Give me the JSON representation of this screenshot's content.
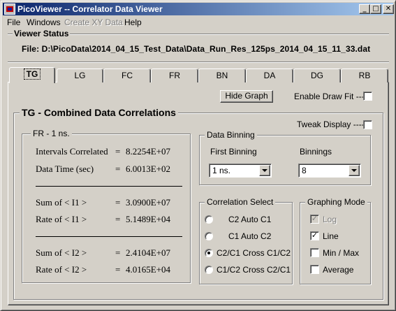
{
  "window": {
    "title": "PicoViewer -- Correlator Data Viewer"
  },
  "titlebar_buttons": {
    "minimize": "_",
    "maximize": "□",
    "close": "✕"
  },
  "menu": [
    {
      "label": "File",
      "enabled": true
    },
    {
      "label": "Windows",
      "enabled": true
    },
    {
      "label": "Create XY Data",
      "enabled": false
    },
    {
      "label": "Help",
      "enabled": true
    }
  ],
  "viewer_status": {
    "title": "Viewer  Status",
    "file_line": "File: D:\\PicoData\\2014_04_15_Test_Data\\Data_Run_Res_125ps_2014_04_15_11_33.dat"
  },
  "tabs": [
    "TG",
    "LG",
    "FC",
    "FR",
    "BN",
    "DA",
    "DG",
    "RB"
  ],
  "active_tab": "TG",
  "toolbar": {
    "hide_graph": "Hide Graph",
    "enable_draw_fit": "Enable Draw Fit ----"
  },
  "panel": {
    "title": "TG - Combined Data Correlations",
    "tweak_display": "Tweak Display ----"
  },
  "fr": {
    "title": "FR - 1 ns.",
    "rows": [
      {
        "label": "Intervals Correlated",
        "eq": "=",
        "value": "8.2254E+07"
      },
      {
        "label": "Data Time (sec)",
        "eq": "=",
        "value": "6.0013E+02"
      },
      {
        "label": "Sum of < I1 >",
        "eq": "=",
        "value": "3.0900E+07"
      },
      {
        "label": "Rate of < I1 >",
        "eq": "=",
        "value": "5.1489E+04"
      },
      {
        "label": "Sum of < I2 >",
        "eq": "=",
        "value": "2.4104E+07"
      },
      {
        "label": "Rate of < I2 >",
        "eq": "=",
        "value": "4.0165E+04"
      }
    ]
  },
  "binning": {
    "title": "Data Binning",
    "first_label": "First Binning",
    "first_value": "1 ns.",
    "binnings_label": "Binnings",
    "binnings_value": "8"
  },
  "correlation": {
    "title": "Correlation Select",
    "options": [
      {
        "label": "C2  Auto  C1",
        "selected": false
      },
      {
        "label": "C1  Auto  C2",
        "selected": false
      },
      {
        "label": "C2/C1 Cross C1/C2",
        "selected": true
      },
      {
        "label": "C1/C2 Cross C2/C1",
        "selected": false
      }
    ]
  },
  "graphing": {
    "title": "Graphing  Mode",
    "options": [
      {
        "label": "Log",
        "checked": true,
        "enabled": false
      },
      {
        "label": "Line",
        "checked": true,
        "enabled": true
      },
      {
        "label": "Min / Max",
        "checked": false,
        "enabled": true
      },
      {
        "label": "Average",
        "checked": false,
        "enabled": true
      }
    ]
  }
}
